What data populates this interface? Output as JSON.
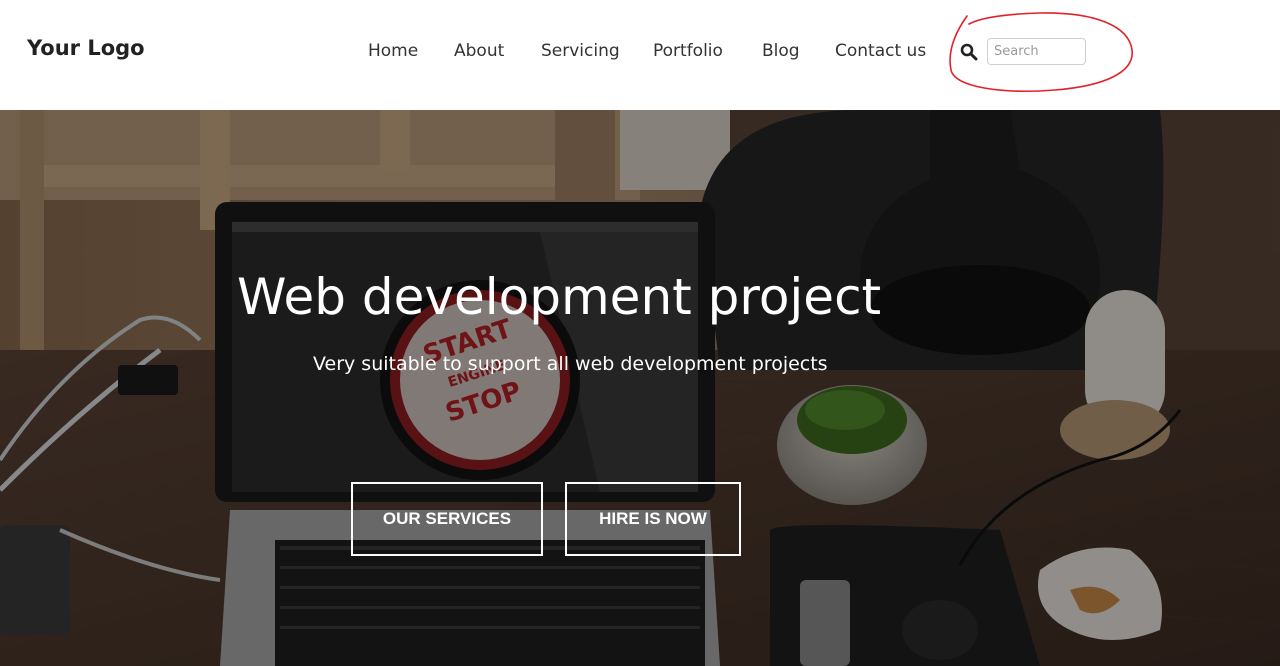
{
  "header": {
    "logo": "Your Logo",
    "nav": [
      {
        "label": "Home"
      },
      {
        "label": "About"
      },
      {
        "label": "Servicing"
      },
      {
        "label": "Portfolio"
      },
      {
        "label": "Blog"
      },
      {
        "label": "Contact us"
      }
    ],
    "search": {
      "placeholder": "Search",
      "value": "",
      "icon": "search-icon"
    }
  },
  "hero": {
    "title": "Web development project",
    "subtitle": "Very suitable to support all web development projects",
    "buttons": {
      "services": "OUR SERVICES",
      "hire": "HIRE IS NOW"
    },
    "screen_text": [
      "START",
      "ENGINE",
      "STOP"
    ]
  },
  "colors": {
    "annotation": "#e0232b",
    "overlay": "#000000",
    "text_light": "#ffffff",
    "nav_text": "#333333"
  }
}
